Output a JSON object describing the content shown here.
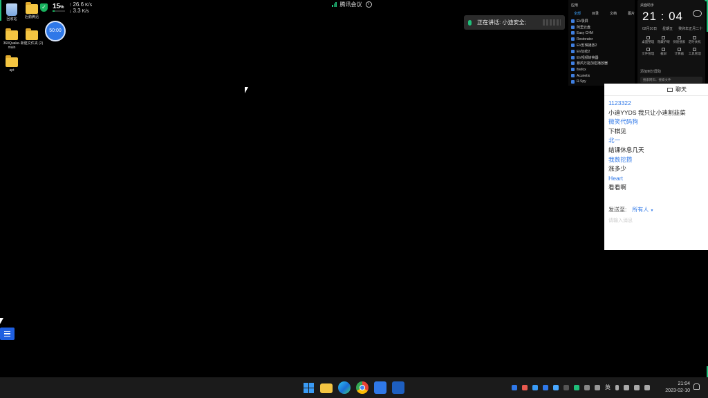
{
  "desktop": {
    "icons": [
      {
        "label": "回收站",
        "icon": "recycle-bin-icon"
      },
      {
        "label": "后勤腾迅",
        "icon": "folder-icon"
      },
      {
        "label": "360Quake-main",
        "icon": "folder-icon"
      },
      {
        "label": "新建文件夹 (2)",
        "icon": "folder-icon"
      },
      {
        "label": "apt",
        "icon": "folder-icon"
      }
    ]
  },
  "monitor": {
    "cpu": "15",
    "cpu_unit": "%",
    "cpu_fraction": 0.15,
    "upload": "26.6",
    "download": "3.3",
    "rate_unit": "K/s",
    "accent": "#19b35f"
  },
  "timer": {
    "value": "50:00",
    "color": "#2f78e8"
  },
  "meeting": {
    "title": "腾讯会议"
  },
  "speaking": {
    "text": "正在讲话: 小迪安全;"
  },
  "apps_panel": {
    "title": "应用",
    "tabs": [
      "全部",
      "目录",
      "文档",
      "图片"
    ],
    "items": [
      "EV录屏",
      "阿里云盘",
      "Easy CHM",
      "Restorator",
      "EV剪辑播放2",
      "EV加密2",
      "EV视频转换器",
      "暴风万能加密播放器",
      "firefox",
      "Acunetix",
      "R.Spy"
    ]
  },
  "clock_widget": {
    "title": "桌面助手",
    "time": "21 : 04",
    "date": "02月10日",
    "weekday": "星期五",
    "lunar": "癸卯年正月二十",
    "tools": [
      "桌面整理",
      "隐藏护眼",
      "快速搜索",
      "定时关机",
      "文件管理",
      "截屏",
      "计算器",
      "工具管理"
    ],
    "add_text": "添加到分屏助",
    "search_placeholder": "搜索网页、搜索文件"
  },
  "chat": {
    "title": "聊天",
    "messages": [
      {
        "sender": "1123322",
        "text": "小迪YYDS  我只让小迪割韭菜"
      },
      {
        "sender": "微笑代码狗",
        "text": "下棋见"
      },
      {
        "sender": "北一",
        "text": "结课休息几天"
      },
      {
        "sender": "我数挖攒",
        "text": "涨多少"
      },
      {
        "sender": "Heart",
        "text": "看看啊"
      }
    ],
    "send_to_label": "发送至:",
    "send_to_value": "所有人",
    "input_placeholder": "请输入消息"
  },
  "taskbar": {
    "apps": [
      "windows-start-icon",
      "file-explorer-icon",
      "edge-icon",
      "chrome-icon",
      "app-blue-icon",
      "app-remote-icon"
    ],
    "ime": "英",
    "time": "21:04",
    "date": "2023-02-10"
  }
}
